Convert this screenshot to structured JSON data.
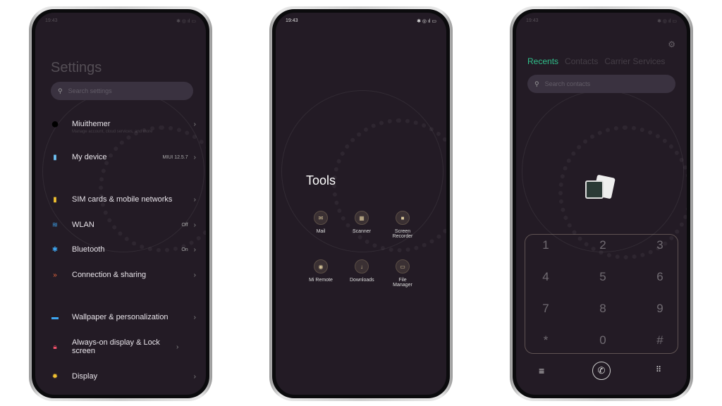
{
  "phones": [
    {
      "status_time": "19:43"
    },
    {
      "status_time": "19:43"
    },
    {
      "status_time": "19:43"
    }
  ],
  "settings": {
    "title": "Settings",
    "search_placeholder": "Search settings",
    "items": [
      {
        "label": "Miuithemer",
        "sub": "Manage account, cloud services, and more",
        "value": "",
        "icon": "avatar-icon",
        "color": "#ffffff"
      },
      {
        "label": "My device",
        "value": "MIUI 12.5.7",
        "icon": "device-icon",
        "color": "#6ec3f5"
      },
      {
        "label": "SIM cards & mobile networks",
        "value": "",
        "icon": "sim-icon",
        "color": "#f2c230"
      },
      {
        "label": "WLAN",
        "value": "Off",
        "icon": "wifi-icon",
        "color": "#3da5f0"
      },
      {
        "label": "Bluetooth",
        "value": "On",
        "icon": "bluetooth-icon",
        "color": "#3da5f0"
      },
      {
        "label": "Connection & sharing",
        "value": "",
        "icon": "share-icon",
        "color": "#f06a3d"
      },
      {
        "label": "Wallpaper & personalization",
        "value": "",
        "icon": "wallpaper-icon",
        "color": "#3da5f0"
      },
      {
        "label": "Always-on display & Lock screen",
        "value": "",
        "icon": "lock-icon",
        "color": "#f0506a"
      },
      {
        "label": "Display",
        "value": "",
        "icon": "sun-icon",
        "color": "#f2c230"
      }
    ]
  },
  "tools": {
    "title": "Tools",
    "items": [
      {
        "label": "Mail",
        "icon": "mail-icon"
      },
      {
        "label": "Scanner",
        "icon": "scanner-icon"
      },
      {
        "label": "Screen Recorder",
        "icon": "video-icon"
      },
      {
        "label": "Mi Remote",
        "icon": "remote-icon"
      },
      {
        "label": "Downloads",
        "icon": "download-icon"
      },
      {
        "label": "File Manager",
        "icon": "folder-icon"
      }
    ]
  },
  "phone_app": {
    "tabs": [
      "Recents",
      "Contacts",
      "Carrier Services"
    ],
    "active_tab_color": "#2fbf8a",
    "search_placeholder": "Search contacts",
    "keys": [
      "1",
      "2",
      "3",
      "4",
      "5",
      "6",
      "7",
      "8",
      "9",
      "*",
      "0",
      "#"
    ]
  }
}
